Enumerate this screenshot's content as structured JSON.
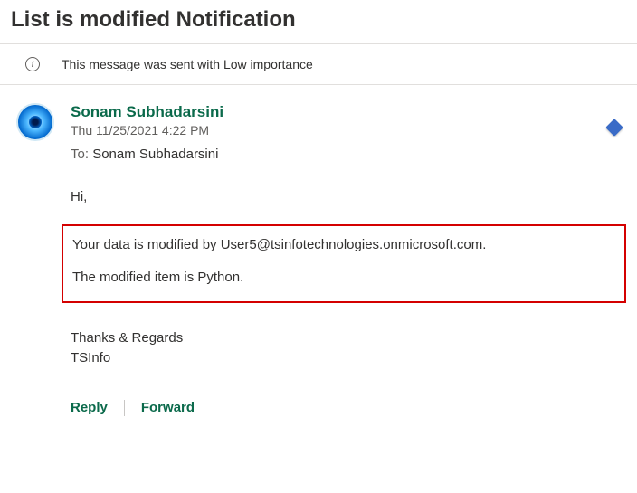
{
  "subject": "List is modified Notification",
  "importance": {
    "text": "This message was sent with Low importance"
  },
  "sender": {
    "name": "Sonam Subhadarsini",
    "timestamp": "Thu 11/25/2021 4:22 PM"
  },
  "recipients": {
    "to_label": "To:",
    "to": "Sonam Subhadarsini"
  },
  "body": {
    "greeting": "Hi,",
    "line1": "Your data is modified by User5@tsinfotechnologies.onmicrosoft.com.",
    "line2": "The modified item is Python.",
    "signature1": "Thanks & Regards",
    "signature2": "TSInfo"
  },
  "actions": {
    "reply": "Reply",
    "forward": "Forward"
  }
}
